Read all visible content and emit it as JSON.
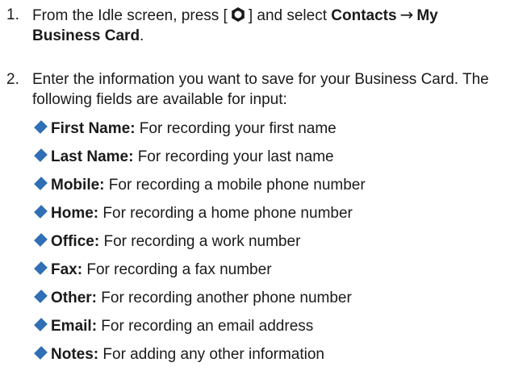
{
  "steps": [
    {
      "number": "1.",
      "line1_pre": "From the Idle screen, press [",
      "line1_key_icon": "navigation-key-icon",
      "line1_post": "] and select",
      "menu_1": "Contacts",
      "arrow": "→",
      "menu_2a": "My",
      "menu_2b": "Business Card",
      "period": "."
    },
    {
      "number": "2.",
      "line1": "Enter the information you want to save for your Business Card. The",
      "line2": "following fields are available for input:"
    }
  ],
  "fields": [
    {
      "name": "First Name:",
      "desc": " For recording your first name"
    },
    {
      "name": "Last Name:",
      "desc": " For recording your last name"
    },
    {
      "name": "Mobile:",
      "desc": " For recording a mobile phone number"
    },
    {
      "name": "Home:",
      "desc": " For recording a home phone number"
    },
    {
      "name": "Office:",
      "desc": " For recording a work number"
    },
    {
      "name": "Fax:",
      "desc": " For recording a fax number"
    },
    {
      "name": "Other:",
      "desc": " For recording another phone number"
    },
    {
      "name": "Email:",
      "desc": " For recording an email address"
    },
    {
      "name": "Notes:",
      "desc": " For adding any other information"
    }
  ],
  "colors": {
    "bullet": "#2f6fb5",
    "text": "#1a1a1a"
  }
}
